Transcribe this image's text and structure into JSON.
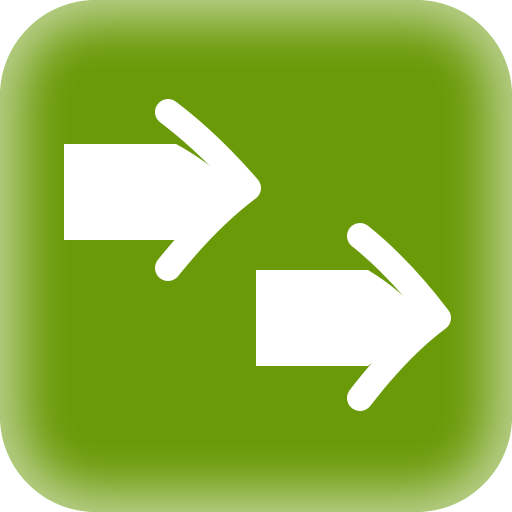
{
  "app_icon": {
    "icon_name": "double-right-arrows-icon",
    "background_color": "#6a9a08",
    "glyph_color": "#ffffff"
  }
}
